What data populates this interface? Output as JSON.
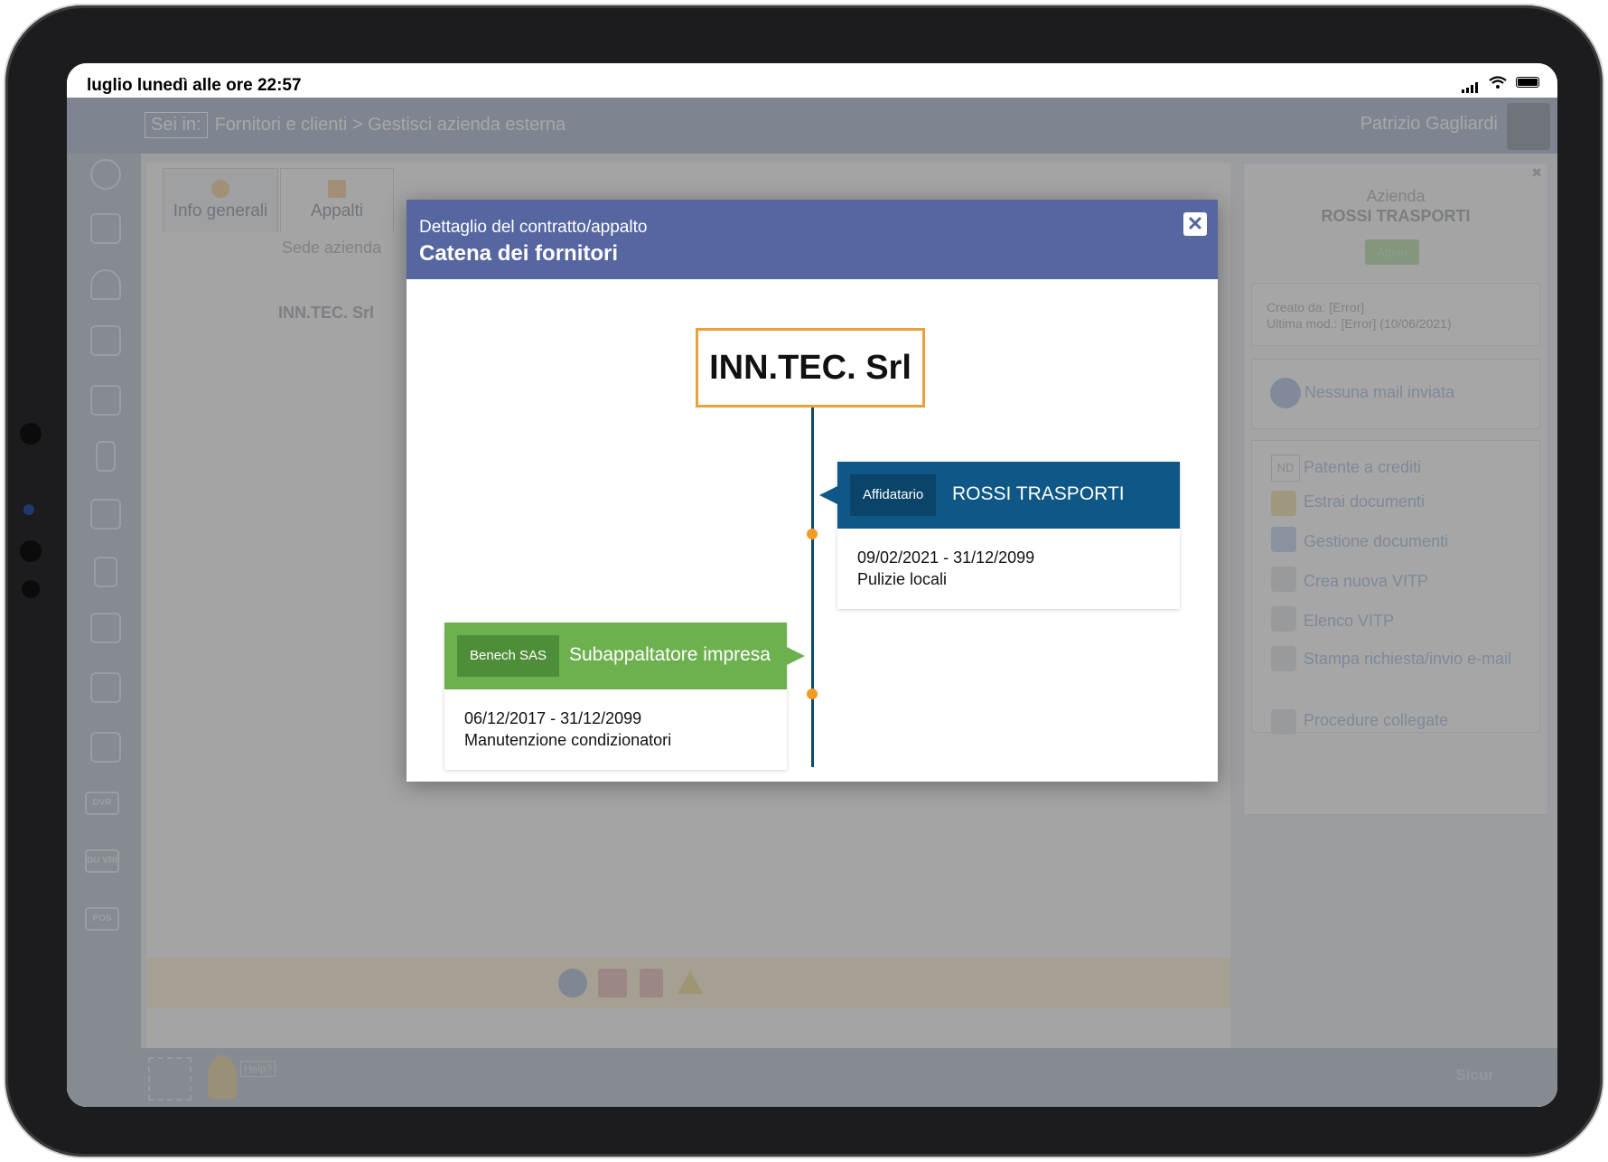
{
  "status_bar": {
    "time": "luglio lunedì alle ore 22:57"
  },
  "topbar": {
    "sei_in": "Sei in:",
    "breadcrumb": "Fornitori e clienti > Gestisci azienda esterna",
    "user_name": "Patrizio Gagliardi"
  },
  "main": {
    "tabs": [
      {
        "label": "Info generali"
      },
      {
        "label": "Appalti"
      }
    ],
    "sede_label": "Sede azienda",
    "company_name": "INN.TEC. Srl"
  },
  "right_panel": {
    "azienda_label": "Azienda",
    "azienda_name": "ROSSI TRASPORTI",
    "stato": "Attivo",
    "creato_da": "Creato da: [Error]",
    "ultima_mod": "Ultima mod.: [Error] (10/06/2021)",
    "mail_status": "Nessuna mail inviata",
    "nd_badge": "ND",
    "links": [
      "Patente a crediti",
      "Estrai documenti",
      "Gestione documenti",
      "Crea nuova VITP",
      "Elenco VITP",
      "Stampa richiesta/invio e-mail",
      "Procedure collegate"
    ]
  },
  "sidebar": {
    "labels": [
      "DVR",
      "DU VRI",
      "POS"
    ]
  },
  "footer": {
    "help_label": "Help?",
    "brand": "Sicur"
  },
  "modal": {
    "subtitle": "Dettaglio del contratto/appalto",
    "title": "Catena dei fornitori",
    "root": "INN.TEC. Srl",
    "chain": [
      {
        "role": "Affidatario",
        "company": "ROSSI TRASPORTI",
        "period": "09/02/2021 - 31/12/2099",
        "description": "Pulizie locali",
        "color": "#0e5786"
      },
      {
        "role": "Benech SAS",
        "company": "Subappaltatore impresa",
        "period": "06/12/2017 - 31/12/2099",
        "description": "Manutenzione condizionatori",
        "color": "#6db14f"
      }
    ],
    "root_border_color": "#e9a23b",
    "dot_color": "#f39a21"
  }
}
